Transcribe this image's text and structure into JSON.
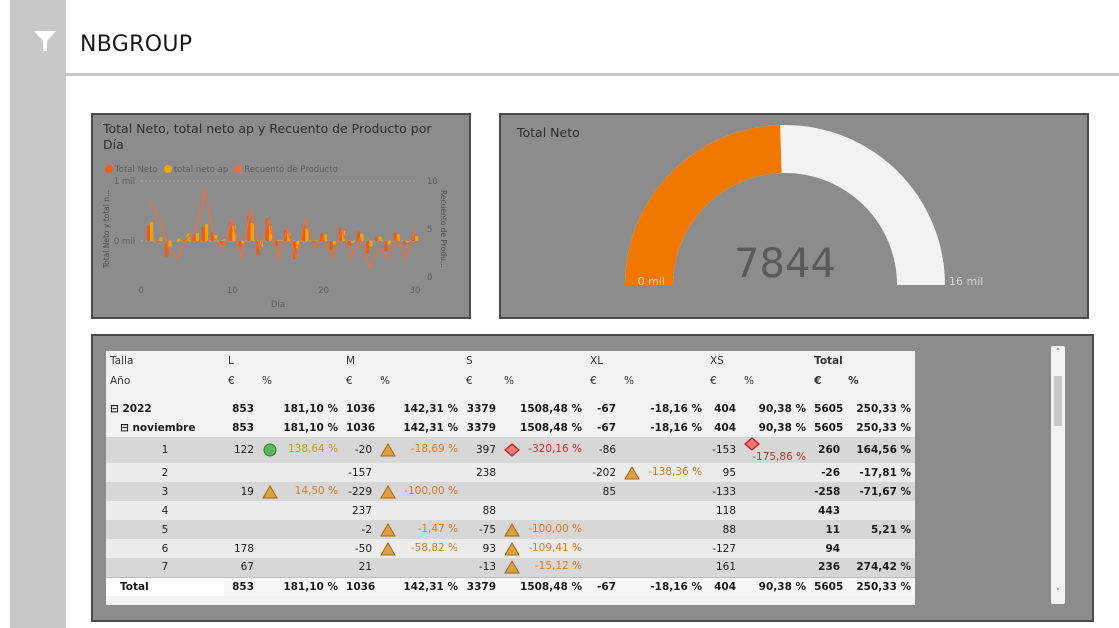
{
  "header": {
    "title": "NBGROUP",
    "filter_icon": "filter-funnel-icon"
  },
  "colors": {
    "total_neto": "#f05a14",
    "total_neto_ap": "#f0a800",
    "recuento": "#e87040",
    "gauge_fill": "#f07800",
    "gauge_bg": "#f2f2f2",
    "panel_bg": "#8c8c8c"
  },
  "combo_chart": {
    "title": "Total Neto, total neto ap y Recuento de Producto por Día",
    "legend": [
      "Total Neto",
      "total neto ap",
      "Recuento de Producto"
    ],
    "ylabel_left": "Total Neto y total n...",
    "ylabel_right": "Recuento de Produ...",
    "xlabel": "Día",
    "yticks_left": [
      "1 mil",
      "0 mil"
    ],
    "yticks_right": [
      "10",
      "5",
      "0"
    ],
    "xticks": [
      "0",
      "10",
      "20",
      "30"
    ]
  },
  "chart_data": [
    {
      "type": "bar",
      "title": "Total Neto, total neto ap y Recuento de Producto por Día",
      "xlabel": "Día",
      "ylabel": "Total Neto y total n...",
      "y2label": "Recuento de Produ...",
      "x": [
        1,
        2,
        3,
        4,
        5,
        6,
        7,
        8,
        9,
        10,
        11,
        12,
        13,
        14,
        15,
        16,
        17,
        18,
        19,
        20,
        21,
        22,
        23,
        24,
        25,
        26,
        27,
        28,
        29,
        30
      ],
      "series": [
        {
          "name": "Total Neto",
          "values": [
            260,
            -26,
            -258,
            0,
            11,
            94,
            236,
            140,
            -60,
            310,
            -120,
            420,
            -240,
            380,
            -90,
            180,
            -300,
            260,
            -40,
            120,
            -150,
            220,
            -80,
            160,
            -200,
            60,
            -170,
            140,
            -60,
            90
          ]
        },
        {
          "name": "total neto ap",
          "values": [
            320,
            60,
            -90,
            40,
            120,
            130,
            280,
            100,
            30,
            260,
            -40,
            300,
            -90,
            250,
            20,
            140,
            -120,
            200,
            10,
            110,
            -60,
            170,
            -30,
            120,
            -90,
            70,
            -60,
            110,
            -20,
            80
          ]
        },
        {
          "name": "Recuento de Producto",
          "values": [
            8,
            6,
            3,
            2,
            4,
            5,
            9,
            4,
            3,
            6,
            2,
            7,
            3,
            6,
            2,
            5,
            2,
            6,
            3,
            4,
            2,
            5,
            2,
            4,
            1,
            3,
            2,
            4,
            2,
            5
          ]
        }
      ],
      "ylim": [
        -600,
        1000
      ],
      "y2lim": [
        0,
        10
      ],
      "xlim": [
        0,
        30
      ]
    },
    {
      "type": "gauge",
      "title": "Total Neto",
      "value": 7844,
      "min": 0,
      "max": 16000
    }
  ],
  "gauge": {
    "title": "Total Neto",
    "value_label": "7844",
    "min_label": "0 mil",
    "max_label": "16 mil"
  },
  "matrix": {
    "col_groups": [
      "Talla",
      "L",
      "M",
      "S",
      "XL",
      "XS",
      "Total"
    ],
    "sub_header": [
      "Año",
      "€",
      "%",
      "€",
      "%",
      "€",
      "%",
      "€",
      "%",
      "€",
      "%",
      "€",
      "%"
    ],
    "rows": [
      {
        "label": "⊟ 2022",
        "kind": "bold",
        "cells": [
          "853",
          "181,10 %",
          "1036",
          "142,31 %",
          "3379",
          "1508,48 %",
          "-67",
          "-18,16 %",
          "404",
          "90,38 %",
          "5605",
          "250,33 %"
        ]
      },
      {
        "label": "⊟ noviembre",
        "kind": "bold",
        "cells": [
          "853",
          "181,10 %",
          "1036",
          "142,31 %",
          "3379",
          "1508,48 %",
          "-67",
          "-18,16 %",
          "404",
          "90,38 %",
          "5605",
          "250,33 %"
        ]
      },
      {
        "label": "1",
        "kind": "odd",
        "cells": [
          "122",
          "138,64 %",
          "-20",
          "-18,69 %",
          "397",
          "-320,16 %",
          "-86",
          "",
          "-153",
          "-175,86 %",
          "260",
          "164,56 %"
        ],
        "ind": [
          "circle-green",
          "tri",
          "diamond-red",
          "",
          "diamond-red"
        ]
      },
      {
        "label": "2",
        "kind": "even",
        "cells": [
          "",
          "",
          "-157",
          "",
          "238",
          "",
          "-202",
          "-138,36 %",
          "95",
          "",
          "-26",
          "-17,81 %"
        ],
        "ind": [
          "",
          "",
          "",
          "tri",
          ""
        ]
      },
      {
        "label": "3",
        "kind": "odd",
        "cells": [
          "19",
          "14,50 %",
          "-229",
          "-100,00 %",
          "",
          "",
          "85",
          "",
          "-133",
          "",
          "-258",
          "-71,67 %"
        ],
        "ind": [
          "tri",
          "tri",
          "",
          "",
          ""
        ]
      },
      {
        "label": "4",
        "kind": "even",
        "cells": [
          "",
          "",
          "237",
          "",
          "88",
          "",
          "",
          "",
          "118",
          "",
          "443",
          ""
        ],
        "ind": [
          "",
          "",
          "",
          "",
          ""
        ]
      },
      {
        "label": "5",
        "kind": "odd",
        "cells": [
          "",
          "",
          "-2",
          "-1,47 %",
          "-75",
          "-100,00 %",
          "",
          "",
          "88",
          "",
          "11",
          "5,21 %"
        ],
        "ind": [
          "",
          "tri",
          "tri",
          "",
          ""
        ]
      },
      {
        "label": "6",
        "kind": "even",
        "cells": [
          "178",
          "",
          "-50",
          "-58,82 %",
          "93",
          "-109,41 %",
          "",
          "",
          "-127",
          "",
          "94",
          ""
        ],
        "ind": [
          "",
          "tri",
          "tri",
          "",
          ""
        ]
      },
      {
        "label": "7",
        "kind": "odd",
        "cells": [
          "67",
          "",
          "21",
          "",
          "-13",
          "-15,12 %",
          "",
          "",
          "161",
          "",
          "236",
          "274,42 %"
        ],
        "ind": [
          "",
          "",
          "tri",
          "",
          ""
        ]
      }
    ],
    "total_row": {
      "label": "Total",
      "cells": [
        "853",
        "181,10 %",
        "1036",
        "142,31 %",
        "3379",
        "1508,48 %",
        "-67",
        "-18,16 %",
        "404",
        "90,38 %",
        "5605",
        "250,33 %"
      ]
    }
  }
}
